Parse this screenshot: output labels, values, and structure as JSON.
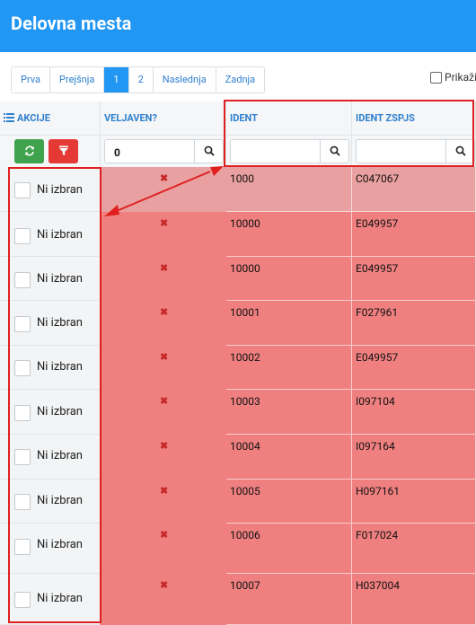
{
  "header": {
    "title": "Delovna mesta"
  },
  "pager": {
    "items": [
      {
        "label": "Prva"
      },
      {
        "label": "Prejšnja"
      },
      {
        "label": "1",
        "active": true
      },
      {
        "label": "2"
      },
      {
        "label": "Naslednja"
      },
      {
        "label": "Zadnja"
      }
    ]
  },
  "show_option": {
    "label": "Prikaži",
    "checked": false
  },
  "columns": {
    "akcije": "AKCIJE",
    "veljaven": "VELJAVEN?",
    "ident": "IDENT",
    "ident_zspjs": "IDENT ZSPJS"
  },
  "filters": {
    "veljaven_value": "0",
    "ident_value": "",
    "ident_zspjs_value": ""
  },
  "rows": [
    {
      "select_label": "Ni izbran",
      "veljaven": "✖",
      "ident": "1000",
      "ident_zspjs": "C047067",
      "highlight": true
    },
    {
      "select_label": "Ni izbran",
      "veljaven": "✖",
      "ident": "10000",
      "ident_zspjs": "E049957"
    },
    {
      "select_label": "Ni izbran",
      "veljaven": "✖",
      "ident": "10000",
      "ident_zspjs": "E049957"
    },
    {
      "select_label": "Ni izbran",
      "veljaven": "✖",
      "ident": "10001",
      "ident_zspjs": "F027961"
    },
    {
      "select_label": "Ni izbran",
      "veljaven": "✖",
      "ident": "10002",
      "ident_zspjs": "E049957"
    },
    {
      "select_label": "Ni izbran",
      "veljaven": "✖",
      "ident": "10003",
      "ident_zspjs": "I097104"
    },
    {
      "select_label": "Ni izbran",
      "veljaven": "✖",
      "ident": "10004",
      "ident_zspjs": "I097164"
    },
    {
      "select_label": "Ni izbran",
      "veljaven": "✖",
      "ident": "10005",
      "ident_zspjs": "H097161"
    },
    {
      "select_label": "Ni izbran",
      "veljaven": "✖",
      "ident": "10006",
      "ident_zspjs": "F017024"
    },
    {
      "select_label": "Ni izbran",
      "veljaven": "✖",
      "ident": "10007",
      "ident_zspjs": "H037004"
    }
  ],
  "colors": {
    "header_bg": "#2196F3",
    "row_invalid": "#f08080",
    "accent": "#2f80cf",
    "annotation": "#e02020"
  }
}
